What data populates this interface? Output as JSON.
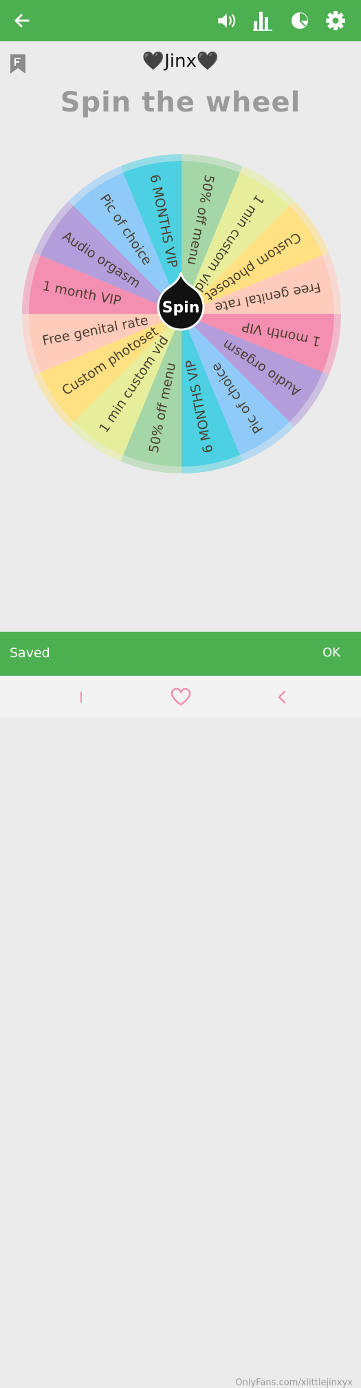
{
  "topbar": {
    "color": "#4caf50",
    "icons": [
      "back-arrow-icon",
      "volume-icon",
      "bar-chart-icon",
      "pie-chart-icon",
      "gear-icon"
    ]
  },
  "profile": {
    "name": "🖤Jinx🖤"
  },
  "heading": "Spin the wheel",
  "wheel": {
    "spin_label": "Spin",
    "slices": [
      {
        "label": "50% off menu",
        "color": "#a5d6a7"
      },
      {
        "label": "1 min custom vid",
        "color": "#e6ee9c"
      },
      {
        "label": "Custom photoset",
        "color": "#ffe082"
      },
      {
        "label": "Free genital rate",
        "color": "#ffccbc"
      },
      {
        "label": "1 month VIP",
        "color": "#f48fb1"
      },
      {
        "label": "Audio orgasm",
        "color": "#b39ddb"
      },
      {
        "label": "Pic of choice",
        "color": "#90caf9"
      },
      {
        "label": "6 MONTHS VIP",
        "color": "#4dd0e1"
      },
      {
        "label": "50% off menu",
        "color": "#a5d6a7"
      },
      {
        "label": "1 min custom vid",
        "color": "#e6ee9c"
      },
      {
        "label": "Custom photoset",
        "color": "#ffe082"
      },
      {
        "label": "Free genital rate",
        "color": "#ffccbc"
      },
      {
        "label": "1 month VIP",
        "color": "#f48fb1"
      },
      {
        "label": "Audio orgasm",
        "color": "#b39ddb"
      },
      {
        "label": "Pic of choice",
        "color": "#90caf9"
      },
      {
        "label": "6 MONTHS VIP",
        "color": "#4dd0e1"
      }
    ]
  },
  "snackbar": {
    "message": "Saved",
    "action": "OK"
  },
  "watermark": "OnlyFans.com/xlittlejinxyx"
}
